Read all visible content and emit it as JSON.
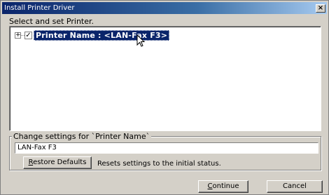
{
  "window": {
    "title": "Install Printer Driver",
    "close_glyph": "×"
  },
  "instruction": "Select and set Printer.",
  "tree": {
    "expander": "+",
    "checked": true,
    "check_glyph": "✓",
    "node_label": "Printer Name : <LAN-Fax F3>"
  },
  "settings": {
    "legend": "Change settings for `Printer Name`",
    "name_value": "LAN-Fax F3",
    "restore_label_first": "R",
    "restore_label_rest": "estore Defaults",
    "reset_text": "Resets settings to the initial status."
  },
  "footer": {
    "continue_first": "C",
    "continue_rest": "ontinue",
    "cancel_label": "Cancel"
  },
  "colors": {
    "titlebar": "#0a246a",
    "selection": "#0a246a",
    "face": "#d4d0c8"
  }
}
